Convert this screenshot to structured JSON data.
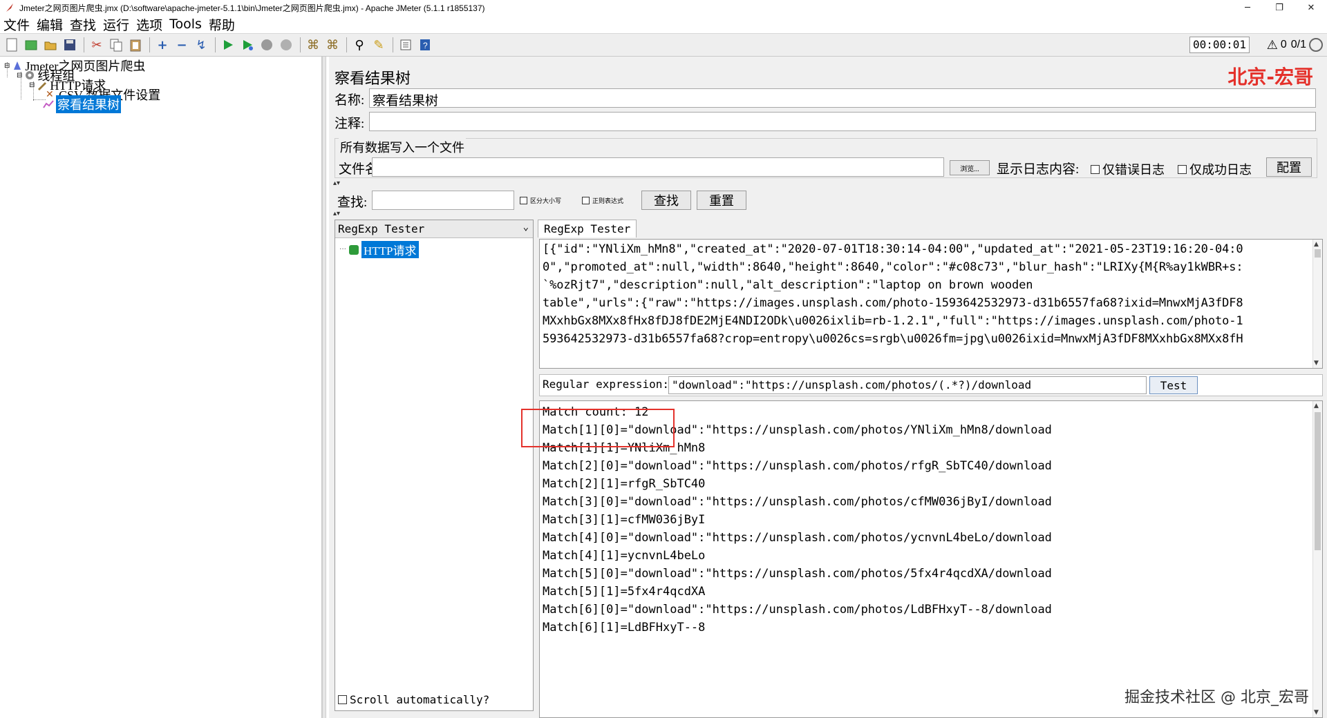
{
  "window": {
    "title": "Jmeter之网页图片爬虫.jmx (D:\\software\\apache-jmeter-5.1.1\\bin\\Jmeter之网页图片爬虫.jmx) - Apache JMeter (5.1.1 r1855137)",
    "minimize": "─",
    "maximize": "❐",
    "close": "✕"
  },
  "menu": [
    "文件",
    "编辑",
    "查找",
    "运行",
    "选项",
    "Tools",
    "帮助"
  ],
  "toolbar": {
    "timer": "00:00:01",
    "warn_count": "0",
    "threads": "0/1"
  },
  "tree": {
    "root": "Jmeter之网页图片爬虫",
    "thread_group": "线程组",
    "http_request": "HTTP请求",
    "csv": "CSV 数据文件设置",
    "result_tree": "察看结果树"
  },
  "panel": {
    "heading": "察看结果树",
    "watermark": "北京-宏哥",
    "name_label": "名称:",
    "name_value": "察看结果树",
    "comment_label": "注释:",
    "comment_value": "",
    "group_title": "所有数据写入一个文件",
    "filename_label": "文件名",
    "filename_value": "",
    "browse_label": "浏览...",
    "log_label": "显示日志内容:",
    "only_errors": "仅错误日志",
    "only_success": "仅成功日志",
    "config_label": "配置",
    "search_label": "查找:",
    "search_value": "",
    "case_sensitive": "区分大小写",
    "regex_label": "正则表达式",
    "find_button": "查找",
    "reset_button": "重置"
  },
  "results": {
    "renderer": "RegExp Tester",
    "item": "HTTP请求",
    "scroll_auto": "Scroll automatically?",
    "tab": "RegExp Tester",
    "response_lines": [
      "[{\"id\":\"YNliXm_hMn8\",\"created_at\":\"2020-07-01T18:30:14-04:00\",\"updated_at\":\"2021-05-23T19:16:20-04:0",
      "0\",\"promoted_at\":null,\"width\":8640,\"height\":8640,\"color\":\"#c08c73\",\"blur_hash\":\"LRIXy{M{R%ay1kWBR+s:",
      "`%ozRjt7\",\"description\":null,\"alt_description\":\"laptop on brown wooden",
      "table\",\"urls\":{\"raw\":\"https://images.unsplash.com/photo-1593642532973-d31b6557fa68?ixid=MnwxMjA3fDF8",
      "MXxhbGx8MXx8fHx8fDJ8fDE2MjE4NDI2ODk\\u0026ixlib=rb-1.2.1\",\"full\":\"https://images.unsplash.com/photo-1",
      "593642532973-d31b6557fa68?crop=entropy\\u0026cs=srgb\\u0026fm=jpg\\u0026ixid=MnwxMjA3fDF8MXxhbGx8MXx8fH"
    ],
    "regex_label": "Regular expression:",
    "regex_value": "\"download\":\"https://unsplash.com/photos/(.*?)/download",
    "test_button": "Test",
    "match_lines": [
      "Match count: 12",
      "Match[1][0]=\"download\":\"https://unsplash.com/photos/YNliXm_hMn8/download",
      "Match[1][1]=YNliXm_hMn8",
      "Match[2][0]=\"download\":\"https://unsplash.com/photos/rfgR_SbTC40/download",
      "Match[2][1]=rfgR_SbTC40",
      "Match[3][0]=\"download\":\"https://unsplash.com/photos/cfMW036jByI/download",
      "Match[3][1]=cfMW036jByI",
      "Match[4][0]=\"download\":\"https://unsplash.com/photos/ycnvnL4beLo/download",
      "Match[4][1]=ycnvnL4beLo",
      "Match[5][0]=\"download\":\"https://unsplash.com/photos/5fx4r4qcdXA/download",
      "Match[5][1]=5fx4r4qcdXA",
      "Match[6][0]=\"download\":\"https://unsplash.com/photos/LdBFHxyT--8/download",
      "Match[6][1]=LdBFHxyT--8"
    ],
    "footer_watermark": "掘金技术社区 @ 北京_宏哥"
  },
  "colors": {
    "accent_red": "#e4312b",
    "selection_blue": "#0078d7",
    "success_green": "#2e9b3a"
  }
}
